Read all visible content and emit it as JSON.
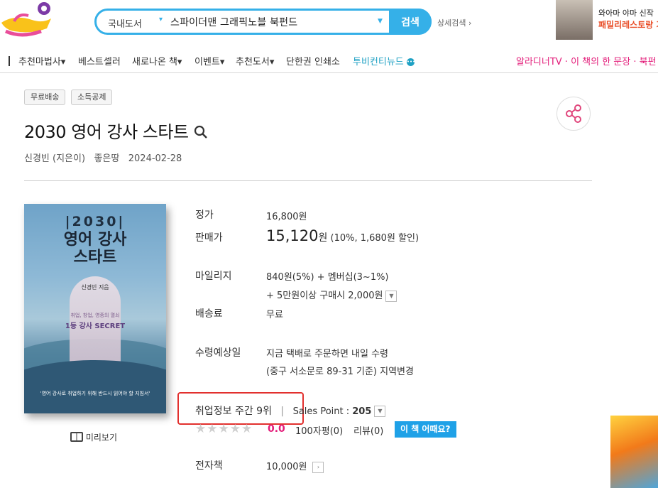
{
  "header": {
    "search": {
      "category": "국내도서",
      "query": "스파이더맨 그래픽노블 북펀드",
      "button_label": "검색"
    },
    "detail_search": "상세검색 ›",
    "ad": {
      "line1": "와아마 야마 신작",
      "line2": "패밀리레스토랑 가"
    }
  },
  "nav": {
    "items": [
      "추천마법사▾",
      "베스트셀러",
      "새로나온 책▾",
      "이벤트▾",
      "추천도서▾",
      "단한권 인쇄소",
      "투비컨티뉴드"
    ],
    "right_text": "알라디너TV · 이 책의 한 문장 · 북펀"
  },
  "book": {
    "badges": [
      "무료배송",
      "소득공제"
    ],
    "title": "2030 영어 강사 스타트",
    "author": "신경빈 (지은이)",
    "publisher": "좋은땅",
    "date": "2024-02-28",
    "cover": {
      "num": "|2030|",
      "title_line1": "영어 강사",
      "title_line2": "스타트",
      "author": "신경빈 지음",
      "sub1": "취업, 창업, 영중의 열쇠",
      "sub2": "1등 강사 SECRET",
      "bottom": "'영어 강사로 취업하기 위해 반드시 읽어야 할 지침서'"
    },
    "preview_label": "미리보기"
  },
  "info": {
    "list_price_label": "정가",
    "list_price": "16,800원",
    "sale_label": "판매가",
    "sale_price": "15,120",
    "sale_unit": "원",
    "sale_discount": " (10%, 1,680원 할인)",
    "mileage_label": "마일리지",
    "mileage_line1": "840원(5%) + 멤버십(3~1%)",
    "mileage_line2": "+ 5만원이상 구매시 2,000원",
    "shipping_label": "배송료",
    "shipping": "무료",
    "delivery_label": "수령예상일",
    "delivery_line1": "지금 택배로 주문하면 내일 수령",
    "delivery_line2": "(중구 서소문로 89-31 기준) 지역변경",
    "rank": "취업정보 주간 9위",
    "sales_point_label": "Sales Point : ",
    "sales_point": "205",
    "stars": "★★★★★",
    "score": "0.0",
    "reviews_100": "100자평(0)",
    "reviews": "리뷰(0)",
    "review_button": "이 책 어때요?",
    "ebook_label": "전자책",
    "ebook_price": "10,000원"
  }
}
